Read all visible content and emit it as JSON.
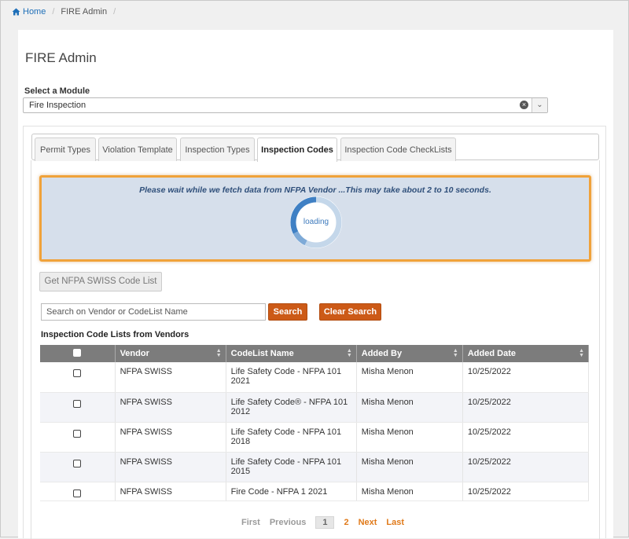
{
  "breadcrumb": {
    "home": "Home",
    "current": "FIRE Admin"
  },
  "page": {
    "title": "FIRE Admin"
  },
  "module": {
    "label": "Select a Module",
    "selected": "Fire Inspection"
  },
  "tabs": [
    {
      "label": "Permit Types"
    },
    {
      "label": "Violation Template"
    },
    {
      "label": "Inspection Types"
    },
    {
      "label": "Inspection Codes"
    },
    {
      "label": "Inspection Code CheckLists"
    }
  ],
  "active_tab": "Inspection Codes",
  "loading": {
    "message": "Please wait while we fetch data from NFPA Vendor ...This may take about 2 to 10 seconds.",
    "spinner_text": "loading"
  },
  "actions": {
    "get_list": "Get NFPA SWISS Code List",
    "search_placeholder": "Search on Vendor or CodeList Name",
    "search": "Search",
    "clear_search": "Clear Search"
  },
  "list": {
    "heading": "Inspection Code Lists from Vendors",
    "columns": [
      "Vendor",
      "CodeList Name",
      "Added By",
      "Added Date"
    ],
    "rows": [
      {
        "vendor": "NFPA SWISS",
        "codelist": "Life Safety Code - NFPA 101 2021",
        "added_by": "Misha Menon",
        "added_date": "10/25/2022"
      },
      {
        "vendor": "NFPA SWISS",
        "codelist": "Life Safety Code® - NFPA 101 2012",
        "added_by": "Misha Menon",
        "added_date": "10/25/2022"
      },
      {
        "vendor": "NFPA SWISS",
        "codelist": "Life Safety Code - NFPA 101 2018",
        "added_by": "Misha Menon",
        "added_date": "10/25/2022"
      },
      {
        "vendor": "NFPA SWISS",
        "codelist": "Life Safety Code - NFPA 101 2015",
        "added_by": "Misha Menon",
        "added_date": "10/25/2022"
      },
      {
        "vendor": "NFPA SWISS",
        "codelist": "Fire Code - NFPA 1 2021",
        "added_by": "Misha Menon",
        "added_date": "10/25/2022"
      }
    ]
  },
  "pager": {
    "first": "First",
    "previous": "Previous",
    "pages": [
      "1",
      "2"
    ],
    "current": "1",
    "next": "Next",
    "last": "Last"
  },
  "colors": {
    "accent": "#cc5a17",
    "loading_border": "#f0a23a",
    "link": "#1e6fb8"
  },
  "icons": {
    "home": "home-icon",
    "clear": "clear-icon",
    "dropdown": "chevron-down-icon",
    "sort": "sort-icon"
  }
}
